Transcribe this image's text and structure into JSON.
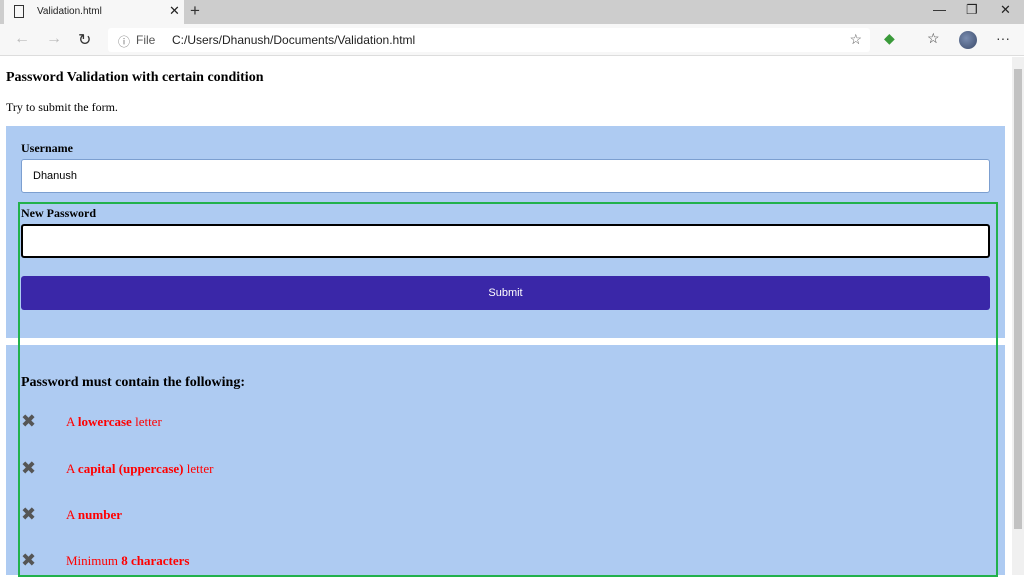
{
  "browser": {
    "tab_title": "Validation.html",
    "url_scheme": "File",
    "url": "C:/Users/Dhanush/Documents/Validation.html"
  },
  "page": {
    "title": "Password Validation with certain condition",
    "hint": "Try to submit the form.",
    "username_label": "Username",
    "username_value": "Dhanush",
    "password_label": "New Password",
    "password_value": "",
    "submit_label": "Submit",
    "requirements_title": "Password must contain the following:",
    "requirements": [
      {
        "pre": "A ",
        "bold": "lowercase",
        "post": " letter",
        "valid": false
      },
      {
        "pre": "A ",
        "bold": "capital (uppercase)",
        "post": " letter",
        "valid": false
      },
      {
        "pre": "A ",
        "bold": "number",
        "post": "",
        "valid": false
      },
      {
        "pre": "Minimum ",
        "bold": "8 characters",
        "post": "",
        "valid": false
      }
    ]
  },
  "colors": {
    "panel": "#aecbf2",
    "button": "#3a27a8",
    "invalid": "#ff0000",
    "outline": "#22b14c"
  }
}
